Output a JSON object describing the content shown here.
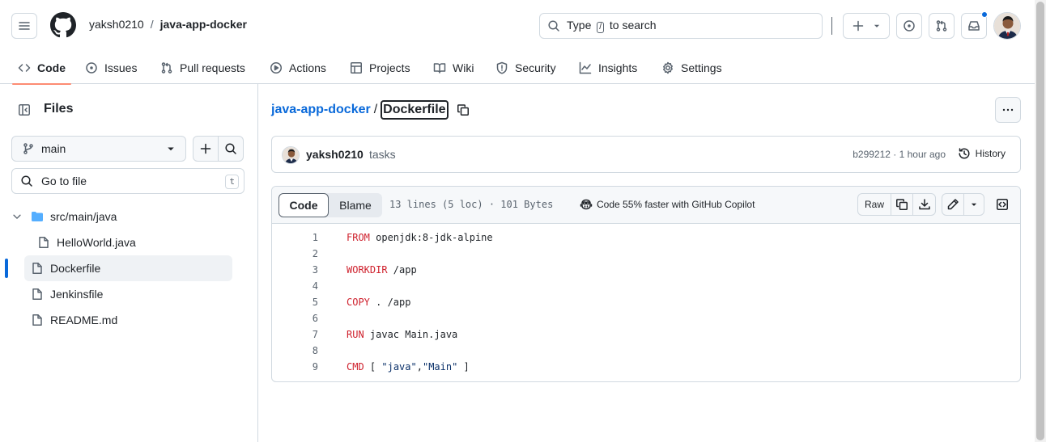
{
  "header": {
    "owner": "yaksh0210",
    "separator": "/",
    "repo": "java-app-docker",
    "search": {
      "before": "Type",
      "key": "/",
      "after": "to search"
    }
  },
  "repo_nav": [
    {
      "label": "Code",
      "icon": "code-icon",
      "active": true
    },
    {
      "label": "Issues",
      "icon": "issue-icon"
    },
    {
      "label": "Pull requests",
      "icon": "pull-request-icon"
    },
    {
      "label": "Actions",
      "icon": "play-icon"
    },
    {
      "label": "Projects",
      "icon": "table-icon"
    },
    {
      "label": "Wiki",
      "icon": "book-icon"
    },
    {
      "label": "Security",
      "icon": "shield-icon"
    },
    {
      "label": "Insights",
      "icon": "graph-icon"
    },
    {
      "label": "Settings",
      "icon": "gear-icon"
    }
  ],
  "sidebar": {
    "title": "Files",
    "branch": "main",
    "goto_placeholder": "Go to file",
    "goto_key": "t",
    "tree": [
      {
        "label": "src/main/java",
        "type": "folder"
      },
      {
        "label": "HelloWorld.java",
        "type": "file"
      },
      {
        "label": "Dockerfile",
        "type": "file",
        "selected": true
      },
      {
        "label": "Jenkinsfile",
        "type": "file"
      },
      {
        "label": "README.md",
        "type": "file"
      }
    ]
  },
  "path": {
    "repo": "java-app-docker",
    "separator": "/",
    "file": "Dockerfile"
  },
  "commit": {
    "user": "yaksh0210",
    "message": "tasks",
    "meta": "b299212 · 1 hour ago",
    "history_label": "History"
  },
  "file": {
    "code_tab": "Code",
    "blame_tab": "Blame",
    "stats": "13 lines (5 loc) · 101 Bytes",
    "copilot": "Code 55% faster with GitHub Copilot",
    "raw_label": "Raw",
    "lines": [
      {
        "n": "1",
        "kw": "FROM",
        "rest": " openjdk:8-jdk-alpine"
      },
      {
        "n": "2",
        "kw": "",
        "rest": ""
      },
      {
        "n": "3",
        "kw": "WORKDIR",
        "rest": " /app"
      },
      {
        "n": "4",
        "kw": "",
        "rest": ""
      },
      {
        "n": "5",
        "kw": "COPY",
        "rest": " . /app"
      },
      {
        "n": "6",
        "kw": "",
        "rest": ""
      },
      {
        "n": "7",
        "kw": "RUN",
        "rest": " javac Main.java"
      },
      {
        "n": "8",
        "kw": "",
        "rest": ""
      },
      {
        "n": "9",
        "kw": "CMD",
        "rest": " [ ",
        "s1": "\"java\"",
        "mid": ",",
        "s2": "\"Main\"",
        "end": " ]"
      }
    ]
  },
  "colors": {
    "accent": "#0969da",
    "tab_underline": "#fd8c73",
    "keyword": "#cf222e",
    "string": "#0a3069"
  }
}
